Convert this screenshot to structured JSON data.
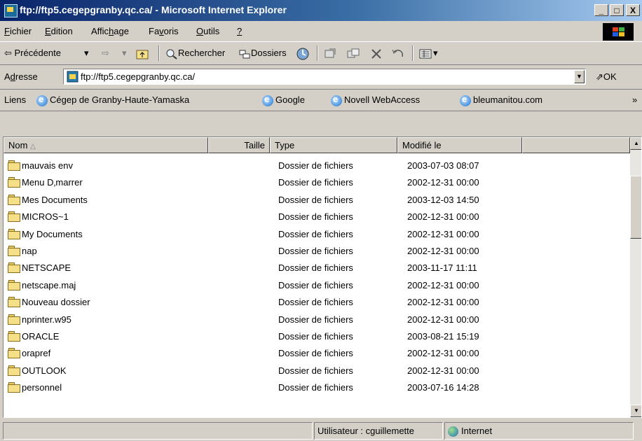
{
  "window": {
    "title": "ftp://ftp5.cegepgranby.qc.ca/ - Microsoft Internet Explorer",
    "minimize": "_",
    "maximize": "□",
    "close": "X"
  },
  "menu": [
    {
      "pre": "",
      "u": "F",
      "post": "ichier"
    },
    {
      "pre": "",
      "u": "E",
      "post": "dition"
    },
    {
      "pre": "Affic",
      "u": "h",
      "post": "age"
    },
    {
      "pre": "Fa",
      "u": "v",
      "post": "oris"
    },
    {
      "pre": "",
      "u": "O",
      "post": "utils"
    },
    {
      "pre": "",
      "u": "?",
      "post": ""
    }
  ],
  "toolbar": {
    "back": "⇦ Précédente",
    "back_arrow": "▾",
    "forward": "⇨",
    "forward_arrow": "▾",
    "search": "Rechercher",
    "folders": "Dossiers",
    "views_arrow": "▾"
  },
  "address": {
    "label_pre": "A",
    "label_u": "d",
    "label_post": "resse",
    "value": "ftp://ftp5.cegepgranby.qc.ca/",
    "go": "OK"
  },
  "links": {
    "label": "Liens",
    "items": [
      "Cégep de Granby-Haute-Yamaska",
      "Google",
      "Novell WebAccess",
      "bleumanitou.com"
    ],
    "more": "»"
  },
  "columns": {
    "name": "Nom",
    "size": "Taille",
    "type": "Type",
    "modified": "Modifié le"
  },
  "files": [
    {
      "name": "mauvais env",
      "type": "Dossier de fichiers",
      "modified": "2003-07-03 08:07"
    },
    {
      "name": "Menu D‚marrer",
      "type": "Dossier de fichiers",
      "modified": "2002-12-31 00:00"
    },
    {
      "name": "Mes Documents",
      "type": "Dossier de fichiers",
      "modified": "2003-12-03 14:50"
    },
    {
      "name": "MICROS~1",
      "type": "Dossier de fichiers",
      "modified": "2002-12-31 00:00"
    },
    {
      "name": "My Documents",
      "type": "Dossier de fichiers",
      "modified": "2002-12-31 00:00"
    },
    {
      "name": "nap",
      "type": "Dossier de fichiers",
      "modified": "2002-12-31 00:00"
    },
    {
      "name": "NETSCAPE",
      "type": "Dossier de fichiers",
      "modified": "2003-11-17 11:11"
    },
    {
      "name": "netscape.maj",
      "type": "Dossier de fichiers",
      "modified": "2002-12-31 00:00"
    },
    {
      "name": "Nouveau dossier",
      "type": "Dossier de fichiers",
      "modified": "2002-12-31 00:00"
    },
    {
      "name": "nprinter.w95",
      "type": "Dossier de fichiers",
      "modified": "2002-12-31 00:00"
    },
    {
      "name": "ORACLE",
      "type": "Dossier de fichiers",
      "modified": "2003-08-21 15:19"
    },
    {
      "name": "orapref",
      "type": "Dossier de fichiers",
      "modified": "2002-12-31 00:00"
    },
    {
      "name": "OUTLOOK",
      "type": "Dossier de fichiers",
      "modified": "2002-12-31 00:00"
    },
    {
      "name": "personnel",
      "type": "Dossier de fichiers",
      "modified": "2003-07-16 14:28"
    }
  ],
  "status": {
    "user": "Utilisateur : cguillemette",
    "zone": "Internet"
  }
}
